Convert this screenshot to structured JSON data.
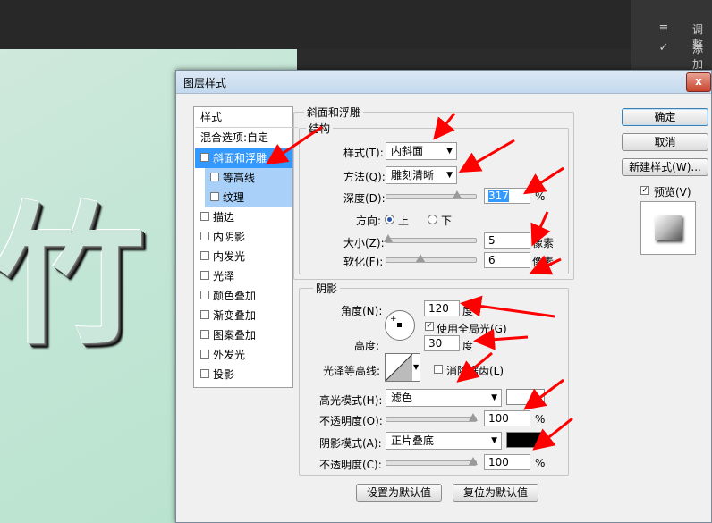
{
  "ps": {
    "right_panel": [
      {
        "icon": "≡",
        "label": "调整"
      },
      {
        "icon": "✓",
        "label": "添加"
      }
    ]
  },
  "canvas": {
    "glyph": "竹"
  },
  "dialog": {
    "title": "图层样式",
    "close_symbol": "x",
    "style_list": {
      "header": "样式",
      "blend_options": "混合选项:自定",
      "items": [
        {
          "label": "斜面和浮雕",
          "checked": true
        },
        {
          "label": "等高线",
          "checked": false
        },
        {
          "label": "纹理",
          "checked": false
        },
        {
          "label": "描边",
          "checked": false
        },
        {
          "label": "内阴影",
          "checked": false
        },
        {
          "label": "内发光",
          "checked": false
        },
        {
          "label": "光泽",
          "checked": false
        },
        {
          "label": "颜色叠加",
          "checked": false
        },
        {
          "label": "渐变叠加",
          "checked": false
        },
        {
          "label": "图案叠加",
          "checked": false
        },
        {
          "label": "外发光",
          "checked": false
        },
        {
          "label": "投影",
          "checked": false
        }
      ]
    },
    "bevel": {
      "group_title": "斜面和浮雕",
      "structure_title": "结构",
      "style_label": "样式(T):",
      "style_value": "内斜面",
      "technique_label": "方法(Q):",
      "technique_value": "雕刻清晰",
      "depth_label": "深度(D):",
      "depth_value": "317",
      "depth_unit": "%",
      "depth_fraction": 0.79,
      "direction_label": "方向:",
      "direction_up": "上",
      "direction_down": "下",
      "size_label": "大小(Z):",
      "size_value": "5",
      "size_unit": "像素",
      "size_fraction": 0.02,
      "soften_label": "软化(F):",
      "soften_value": "6",
      "soften_unit": "像素",
      "soften_fraction": 0.38
    },
    "shading": {
      "group_title": "阴影",
      "angle_label": "角度(N):",
      "angle_value": "120",
      "angle_unit": "度",
      "global_light_label": "使用全局光(G)",
      "global_light_checked": true,
      "altitude_label": "高度:",
      "altitude_value": "30",
      "altitude_unit": "度",
      "gloss_label": "光泽等高线:",
      "antialias_label": "消除锯齿(L)",
      "highlight_mode_label": "高光模式(H):",
      "highlight_mode_value": "滤色",
      "highlight_color": "#ffffff",
      "highlight_opacity_label": "不透明度(O):",
      "highlight_opacity_value": "100",
      "highlight_opacity_unit": "%",
      "shadow_mode_label": "阴影模式(A):",
      "shadow_mode_value": "正片叠底",
      "shadow_color": "#000000",
      "shadow_opacity_label": "不透明度(C):",
      "shadow_opacity_value": "100",
      "shadow_opacity_unit": "%"
    },
    "buttons": {
      "ok": "确定",
      "cancel": "取消",
      "new_style": "新建样式(W)...",
      "preview": "预览(V)",
      "preview_checked": true,
      "make_default": "设置为默认值",
      "reset_default": "复位为默认值"
    }
  },
  "annotation_color": "#ff0000"
}
